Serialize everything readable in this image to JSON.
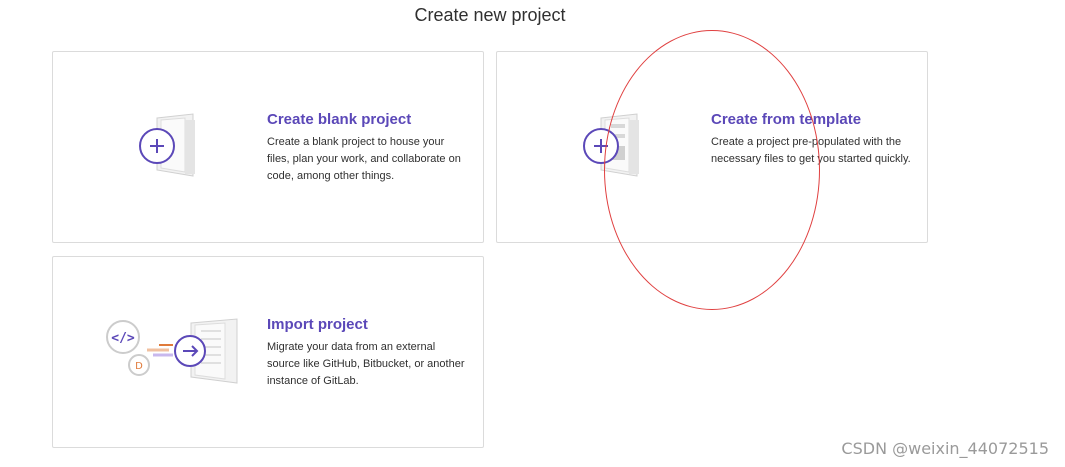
{
  "page": {
    "title": "Create new project"
  },
  "cards": {
    "blank": {
      "title": "Create blank project",
      "description": "Create a blank project to house your files, plan your work, and collaborate on code, among other things.",
      "icon": "plus-document-icon"
    },
    "template": {
      "title": "Create from template",
      "description": "Create a project pre-populated with the necessary files to get you started quickly.",
      "icon": "template-document-icon"
    },
    "import": {
      "title": "Import project",
      "description": "Migrate your data from an external source like GitHub, Bitbucket, or another instance of GitLab.",
      "icon": "import-arrow-icon"
    }
  },
  "colors": {
    "accent": "#5b48b8",
    "annotation": "#e04040",
    "border": "#dbdbdb"
  },
  "watermark": "CSDN @weixin_44072515"
}
